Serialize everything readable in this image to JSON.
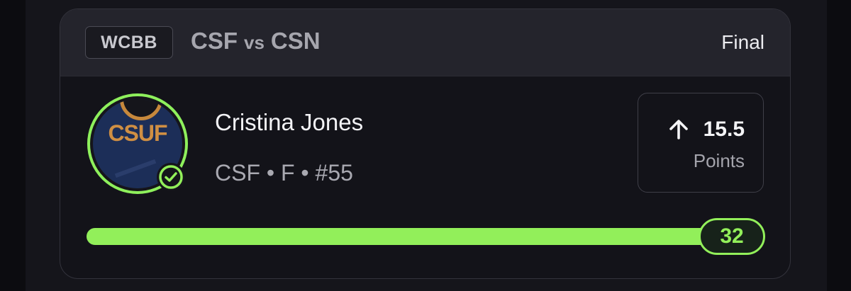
{
  "header": {
    "league": "WCBB",
    "home_team": "CSF",
    "vs": "vs",
    "away_team": "CSN",
    "status": "Final"
  },
  "player": {
    "name": "Cristina Jones",
    "meta": "CSF • F • #55",
    "jersey_text": "CSUF",
    "verified": true,
    "jersey_icon": "jersey-avatar-icon",
    "check_icon": "check-circle-icon"
  },
  "projection": {
    "direction_icon": "arrow-up-icon",
    "line": "15.5",
    "stat": "Points"
  },
  "result": {
    "actual": "32",
    "progress_fraction": 1.0
  },
  "colors": {
    "accent_green": "#92ef5a",
    "card_bg": "#131319",
    "header_bg": "#24242c",
    "jersey_navy": "#1c2e58",
    "jersey_gold": "#d08f43"
  }
}
